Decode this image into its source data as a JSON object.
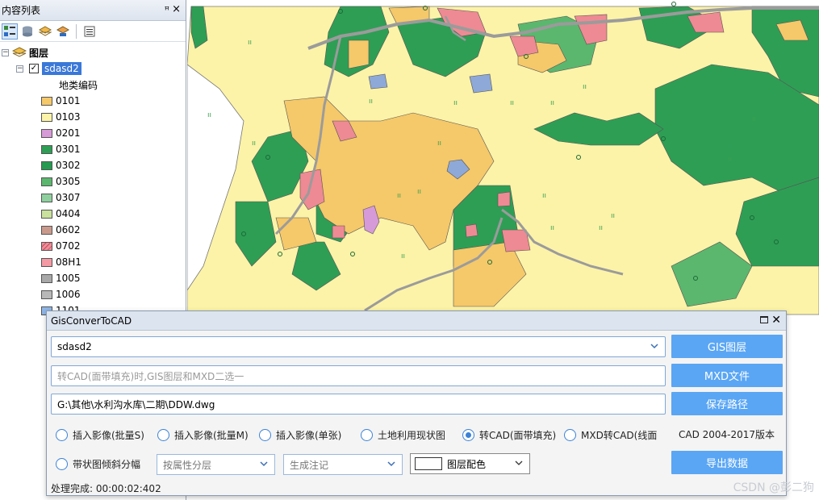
{
  "toc": {
    "title": "内容列表",
    "pin_glyph": "ꟸ",
    "close_glyph": "×",
    "layers_root": "图层",
    "layer_name": "sdasd2",
    "field_heading": "地类编码",
    "legend": [
      {
        "code": "0101",
        "color": "#f5c86a"
      },
      {
        "code": "0103",
        "color": "#fcf3a8"
      },
      {
        "code": "0201",
        "color": "#d79ad8"
      },
      {
        "code": "0301",
        "color": "#2e9e55"
      },
      {
        "code": "0302",
        "color": "#259a50"
      },
      {
        "code": "0305",
        "color": "#5bb76e"
      },
      {
        "code": "0307",
        "color": "#8fcf9e"
      },
      {
        "code": "0404",
        "color": "#c9e19c"
      },
      {
        "code": "0602",
        "color": "#c99a8c"
      },
      {
        "code": "0702",
        "color": "#f08c98"
      },
      {
        "code": "08H1",
        "color": "#f59aa4"
      },
      {
        "code": "1005",
        "color": "#a8a8a8"
      },
      {
        "code": "1006",
        "color": "#b8b8b8"
      },
      {
        "code": "1101",
        "color": "#8fb6e8"
      }
    ]
  },
  "map": {
    "colors": {
      "base": "#fcf3a8",
      "forest": "#2e9e55",
      "orchard": "#f5c86a",
      "residential": "#ee8a93",
      "road": "#9b9b9b",
      "water": "#8ea9d8",
      "garden": "#c98ccb"
    }
  },
  "dialog": {
    "title": "GisConverToCAD",
    "layer_select": "sdasd2",
    "mxd_placeholder": "转CAD(面带填充)时,GIS图层和MXD二选一",
    "save_path": "G:\\其他\\水利沟水库\\二期\\DDW.dwg",
    "buttons": {
      "gis_layer": "GIS图层",
      "mxd_file": "MXD文件",
      "save_path": "保存路径",
      "export": "导出数据"
    },
    "radios_row1": [
      {
        "label": "插入影像(批量S)",
        "checked": false
      },
      {
        "label": "插入影像(批量M)",
        "checked": false
      },
      {
        "label": "插入影像(单张)",
        "checked": false
      },
      {
        "label": "土地利用现状图",
        "checked": false
      },
      {
        "label": "转CAD(面带填充)",
        "checked": true
      },
      {
        "label": "MXD转CAD(线面",
        "checked": false
      }
    ],
    "cad_version": "CAD  2004-2017版本",
    "radio_row2": {
      "label": "带状图倾斜分幅",
      "checked": false
    },
    "attr_layer_placeholder": "按属性分层",
    "annotation_placeholder": "生成注记",
    "color_scheme_label": "图层配色",
    "status": "处理完成:  00:00:02:402"
  },
  "watermark": "CSDN @彭二狗"
}
